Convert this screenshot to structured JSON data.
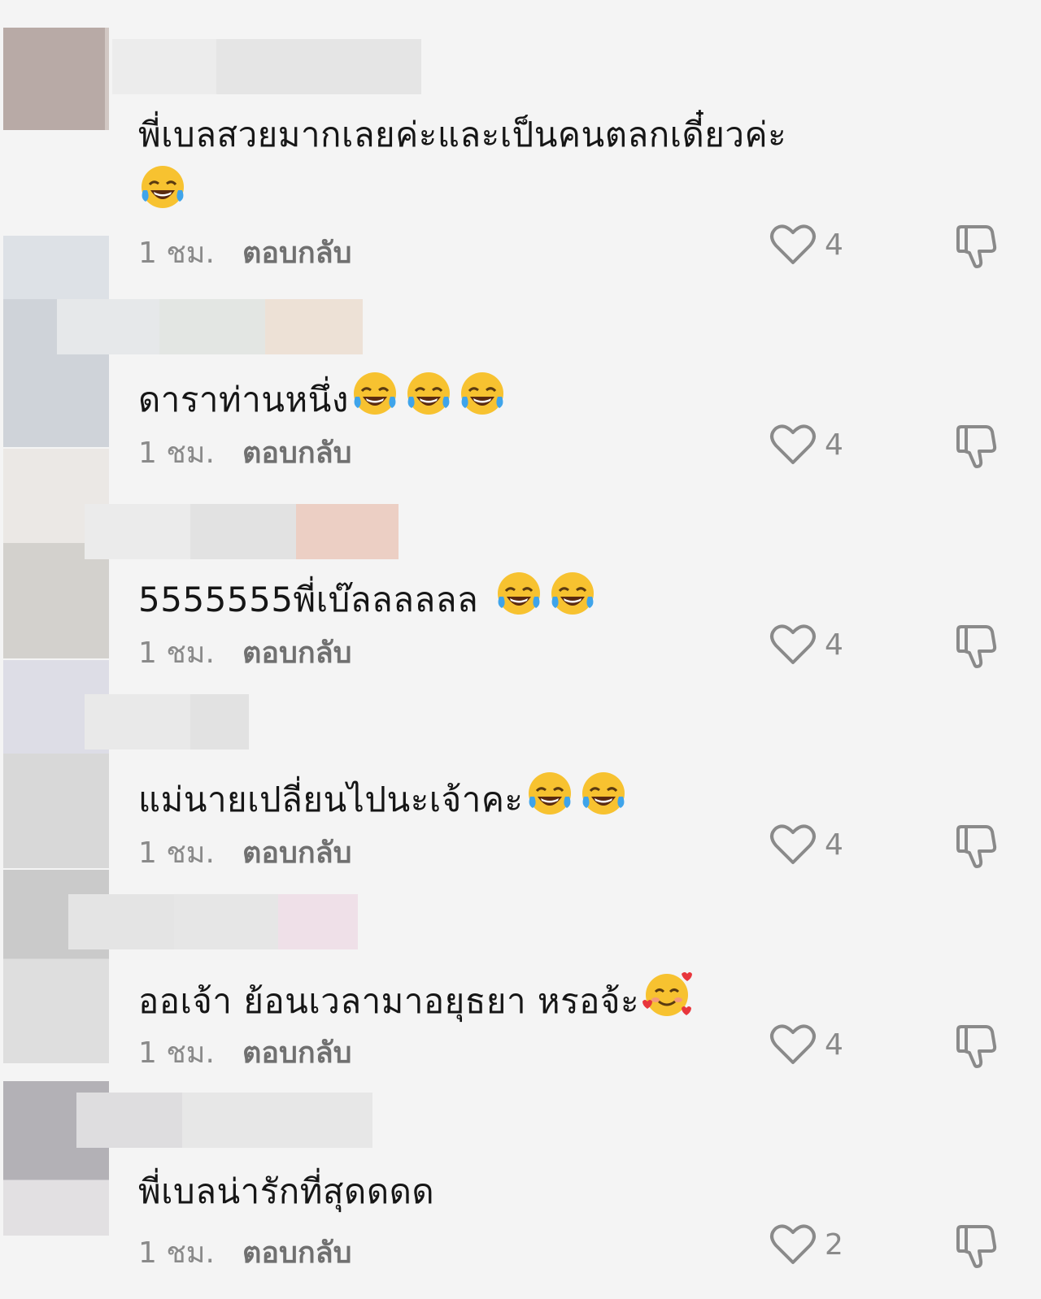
{
  "comments": [
    {
      "text": "พี่เบลสวยมากเลยค่ะและเป็นคนตลกเดี๋ยวค่ะ",
      "emoji_icons": [
        "face-with-tears-of-joy-icon"
      ],
      "time": "1 ชม.",
      "reply_label": "ตอบกลับ",
      "likes": "4"
    },
    {
      "text": "ดาราท่านหนึ่ง",
      "emoji_icons": [
        "face-with-tears-of-joy-icon",
        "face-with-tears-of-joy-icon",
        "face-with-tears-of-joy-icon"
      ],
      "time": "1 ชม.",
      "reply_label": "ตอบกลับ",
      "likes": "4"
    },
    {
      "text": "5555555พี่เบ๊ลลลลลล",
      "emoji_icons": [
        "face-with-tears-of-joy-icon",
        "face-with-tears-of-joy-icon"
      ],
      "time": "1 ชม.",
      "reply_label": "ตอบกลับ",
      "likes": "4"
    },
    {
      "text": "แม่นายเปลี่ยนไปนะเจ้าคะ",
      "emoji_icons": [
        "face-with-tears-of-joy-icon",
        "face-with-tears-of-joy-icon"
      ],
      "time": "1 ชม.",
      "reply_label": "ตอบกลับ",
      "likes": "4"
    },
    {
      "text": "ออเจ้า ย้อนเวลามาอยุธยา หรอจ้ะ",
      "emoji_icons": [
        "smiling-face-with-hearts-icon"
      ],
      "time": "1 ชม.",
      "reply_label": "ตอบกลับ",
      "likes": "4"
    },
    {
      "text": "พี่เบลน่ารักที่สุดดดด",
      "emoji_icons": [],
      "time": "1 ชม.",
      "reply_label": "ตอบกลับ",
      "likes": "2"
    }
  ],
  "icons": {
    "like": "heart-outline-icon",
    "dislike": "thumbs-down-icon"
  },
  "colors": {
    "background": "#f4f4f4",
    "text": "#161616",
    "meta": "#8a8a8a",
    "emoji_face": "#f7c230",
    "emoji_tear": "#3fa4ea"
  }
}
